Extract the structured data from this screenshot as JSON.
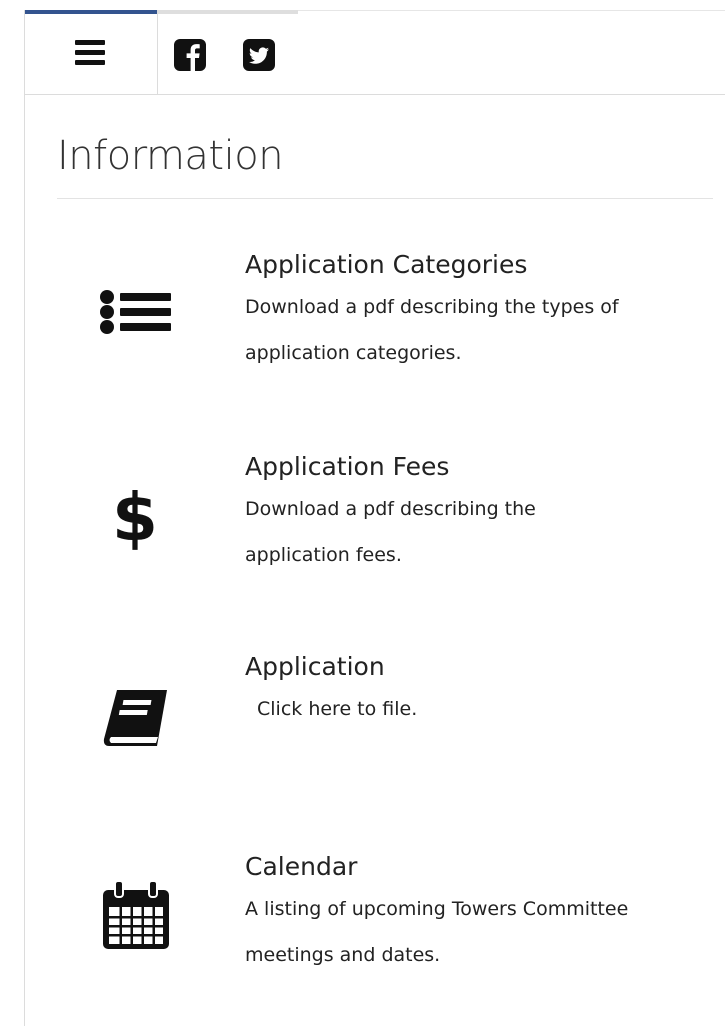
{
  "header": {
    "menu_icon": "bars-icon",
    "social": [
      {
        "icon": "facebook-icon"
      },
      {
        "icon": "twitter-icon"
      }
    ],
    "active_tab_color": "#33548f"
  },
  "main": {
    "title": "Information",
    "items": [
      {
        "icon": "list-icon",
        "heading": "Application Categories",
        "description": "Download a pdf describing the types of application categories."
      },
      {
        "icon": "dollar-icon",
        "heading": "Application Fees",
        "description": "Download a pdf describing the application fees."
      },
      {
        "icon": "book-icon",
        "heading": "Application",
        "description": "Click here to file."
      },
      {
        "icon": "calendar-icon",
        "heading": "Calendar",
        "description": "A listing of upcoming Towers Committee meetings and dates."
      }
    ]
  }
}
